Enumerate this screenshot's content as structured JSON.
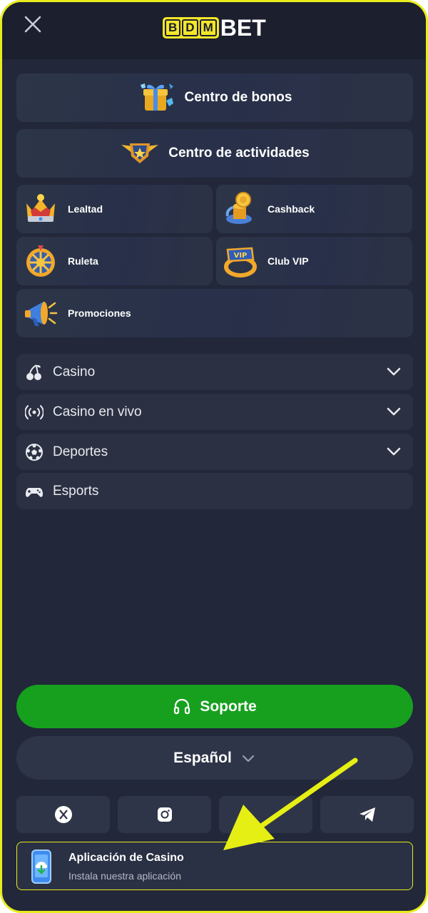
{
  "header": {
    "logo_letters": [
      "B",
      "D",
      "M"
    ],
    "logo_suffix": "BET"
  },
  "cards": {
    "bonus_center": "Centro de bonos",
    "activity_center": "Centro de actividades",
    "loyalty": "Lealtad",
    "cashback": "Cashback",
    "roulette": "Ruleta",
    "vip": "Club VIP",
    "promotions": "Promociones"
  },
  "menu": [
    {
      "label": "Casino",
      "icon": "cherry-icon",
      "expandable": true
    },
    {
      "label": "Casino en vivo",
      "icon": "broadcast-icon",
      "expandable": true
    },
    {
      "label": "Deportes",
      "icon": "soccer-ball-icon",
      "expandable": true
    },
    {
      "label": "Esports",
      "icon": "gamepad-icon",
      "expandable": false
    }
  ],
  "support_label": "Soporte",
  "language_label": "Español",
  "social": [
    "x-icon",
    "instagram-icon",
    "",
    "telegram-icon"
  ],
  "app_banner": {
    "title": "Aplicación de Casino",
    "subtitle": "Instala nuestra aplicación"
  },
  "colors": {
    "accent": "#e8ec1a",
    "support_green": "#16a01e",
    "background": "#22273a",
    "card": "#2b3144"
  }
}
